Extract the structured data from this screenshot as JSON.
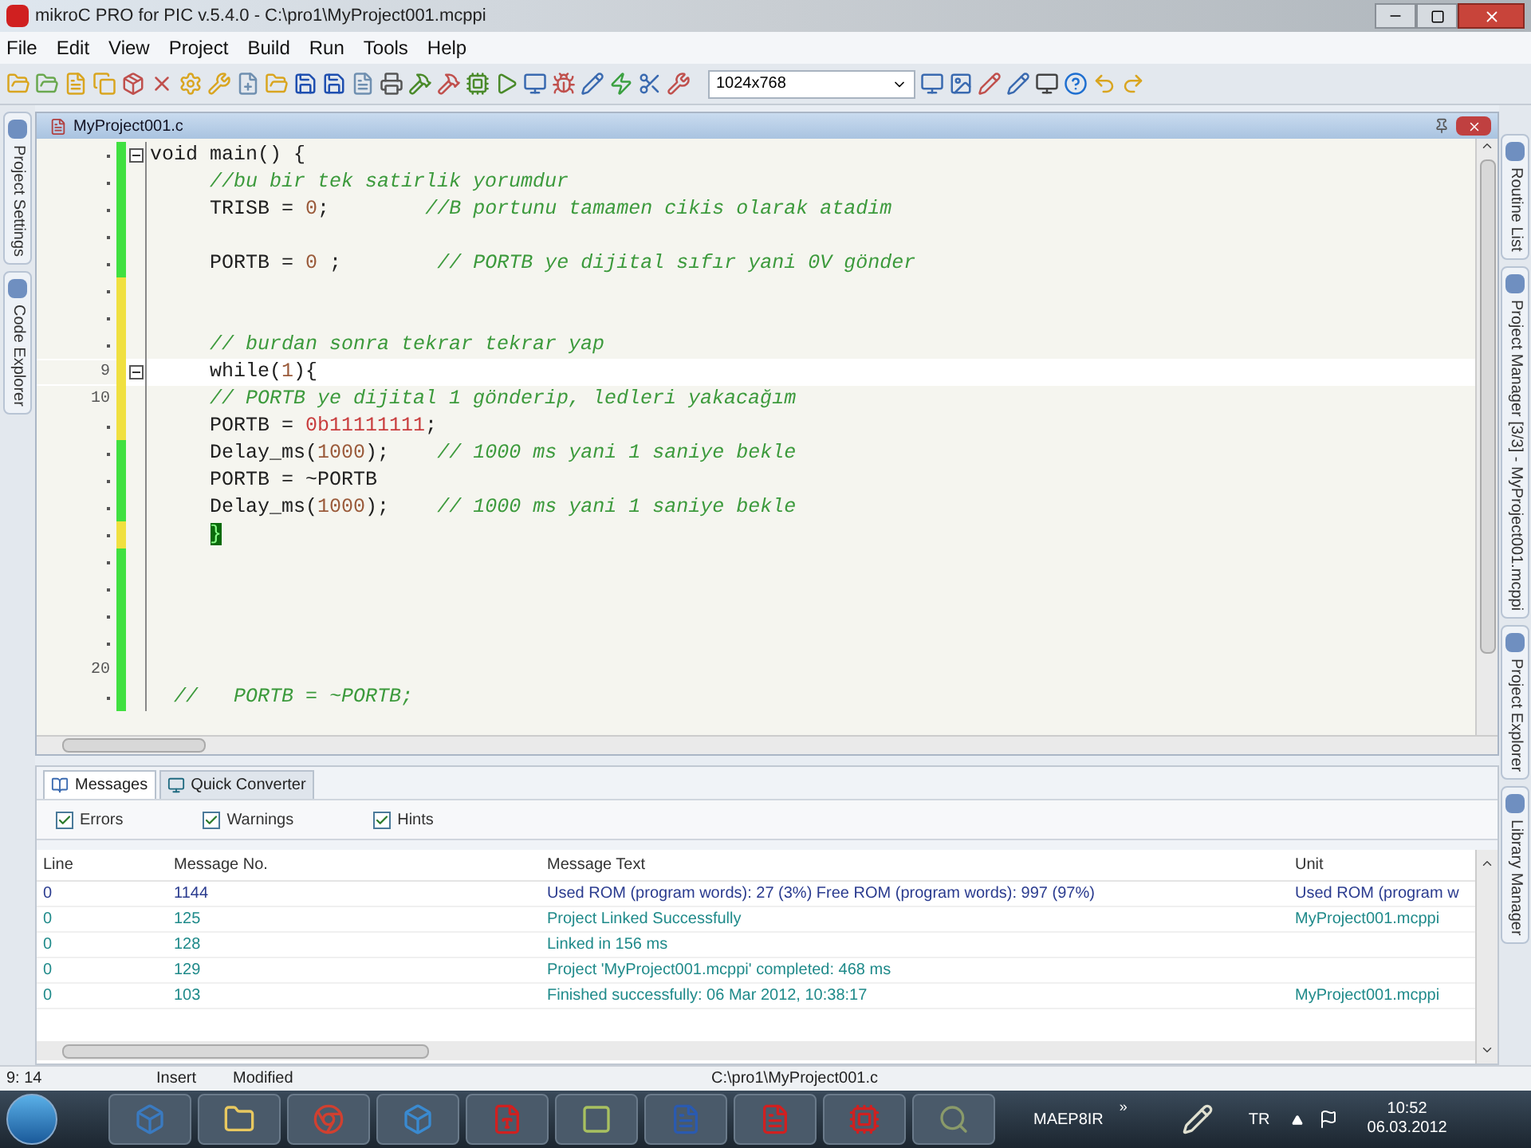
{
  "window": {
    "title": "mikroC PRO for PIC v.5.4.0 - C:\\pro1\\MyProject001.mcppi"
  },
  "menu": [
    "File",
    "Edit",
    "View",
    "Project",
    "Build",
    "Run",
    "Tools",
    "Help"
  ],
  "toolbar": {
    "resolution": "1024x768"
  },
  "left_tabs": [
    "Project Settings",
    "Code Explorer"
  ],
  "right_tabs": [
    "Routine List",
    "Project Manager [3/3] - MyProject001.mcppi",
    "Project Explorer",
    "Library Manager"
  ],
  "editor": {
    "tab": "MyProject001.c",
    "lines": [
      {
        "modified": false,
        "fold": true,
        "current": false,
        "segments": [
          {
            "kind": "code",
            "text": "void main() {"
          }
        ]
      },
      {
        "modified": false,
        "fold": false,
        "current": false,
        "segments": [
          {
            "kind": "comment",
            "text": "     //bu bir tek satirlik yorumdur"
          }
        ]
      },
      {
        "modified": false,
        "fold": false,
        "current": false,
        "segments": [
          {
            "kind": "code",
            "text": "     TRISB = "
          },
          {
            "kind": "number",
            "text": "0"
          },
          {
            "kind": "code",
            "text": ";        "
          },
          {
            "kind": "comment",
            "text": "//B portunu tamamen cikis olarak atadim"
          }
        ]
      },
      {
        "modified": false,
        "fold": false,
        "current": false
      },
      {
        "modified": false,
        "fold": false,
        "current": false,
        "segments": [
          {
            "kind": "code",
            "text": "     PORTB = "
          },
          {
            "kind": "number",
            "text": "0"
          },
          {
            "kind": "code",
            "text": " ;        "
          },
          {
            "kind": "comment",
            "text": "// PORTB ye dijital sıfır yani 0V gönder"
          }
        ]
      },
      {
        "modified": true,
        "fold": false,
        "current": false
      },
      {
        "modified": true,
        "fold": false,
        "current": false
      },
      {
        "modified": true,
        "fold": false,
        "current": false,
        "segments": [
          {
            "kind": "comment",
            "text": "     // burdan sonra tekrar tekrar yap"
          }
        ]
      },
      {
        "number": "9",
        "modified": true,
        "fold": true,
        "current": true,
        "segments": [
          {
            "kind": "code",
            "text": "     while("
          },
          {
            "kind": "number",
            "text": "1"
          },
          {
            "kind": "code",
            "text": "){"
          }
        ]
      },
      {
        "number": "10",
        "modified": true,
        "fold": false,
        "current": false,
        "segments": [
          {
            "kind": "comment",
            "text": "     // PORTB ye dijital 1 gönderip, ledleri yakacağım"
          }
        ]
      },
      {
        "modified": true,
        "fold": false,
        "current": false,
        "segments": [
          {
            "kind": "code",
            "text": "     PORTB = "
          },
          {
            "kind": "string",
            "text": "0b11111111"
          },
          {
            "kind": "code",
            "text": ";"
          }
        ]
      },
      {
        "modified": false,
        "fold": false,
        "current": false,
        "segments": [
          {
            "kind": "code",
            "text": "     Delay_ms("
          },
          {
            "kind": "number",
            "text": "1000"
          },
          {
            "kind": "code",
            "text": ");    "
          },
          {
            "kind": "comment",
            "text": "// 1000 ms yani 1 saniye bekle"
          }
        ]
      },
      {
        "modified": false,
        "fold": false,
        "current": false,
        "segments": [
          {
            "kind": "code",
            "text": "     PORTB = ~PORTB"
          }
        ]
      },
      {
        "modified": false,
        "fold": false,
        "current": false,
        "segments": [
          {
            "kind": "code",
            "text": "     Delay_ms("
          },
          {
            "kind": "number",
            "text": "1000"
          },
          {
            "kind": "code",
            "text": ");    "
          },
          {
            "kind": "comment",
            "text": "// 1000 ms yani 1 saniye bekle"
          }
        ]
      },
      {
        "modified": true,
        "fold": false,
        "current": false,
        "segments": [
          {
            "kind": "bracket",
            "text": "     }"
          }
        ]
      },
      {
        "modified": false,
        "fold": false,
        "current": false
      },
      {
        "modified": false,
        "fold": false,
        "current": false
      },
      {
        "modified": false,
        "fold": false,
        "current": false
      },
      {
        "modified": false,
        "fold": false,
        "current": false
      },
      {
        "number": "20",
        "modified": false,
        "fold": false,
        "current": false
      },
      {
        "modified": false,
        "fold": false,
        "current": false,
        "segments": [
          {
            "kind": "comment",
            "text": "  //   PORTB = ~PORTB;"
          }
        ]
      }
    ]
  },
  "messages": {
    "tabs": [
      {
        "label": "Messages",
        "selected": true
      },
      {
        "label": "Quick Converter",
        "selected": false
      }
    ],
    "filters": [
      {
        "label": "Errors",
        "checked": true
      },
      {
        "label": "Warnings",
        "checked": true
      },
      {
        "label": "Hints",
        "checked": true
      }
    ],
    "columns": [
      "Line",
      "Message No.",
      "Message Text",
      "Unit"
    ],
    "rows": [
      {
        "line": "0",
        "number": "1144",
        "text": "Used ROM (program words): 27 (3%)  Free ROM (program words): 997 (97%)",
        "unit": "Used ROM (program w",
        "color": "#2a3b8f"
      },
      {
        "line": "0",
        "number": "125",
        "text": "Project Linked Successfully",
        "unit": "MyProject001.mcppi",
        "color": "#1f8a8a"
      },
      {
        "line": "0",
        "number": "128",
        "text": "Linked in 156 ms",
        "color": "#1f8a8a"
      },
      {
        "line": "0",
        "number": "129",
        "text": "Project 'MyProject001.mcppi' completed: 468 ms",
        "color": "#1f8a8a"
      },
      {
        "line": "0",
        "number": "103",
        "text": "Finished successfully: 06 Mar 2012, 10:38:17",
        "unit": "MyProject001.mcppi",
        "color": "#1f8a8a"
      }
    ]
  },
  "status_bar": {
    "position": "9: 14",
    "mode": "Insert",
    "state": "Modified",
    "path": "C:\\pro1\\MyProject001.c"
  },
  "taskbar": {
    "label": "MAEP8IR",
    "more": "»",
    "language": "TR",
    "time": "10:52",
    "date": "06.03.2012"
  }
}
